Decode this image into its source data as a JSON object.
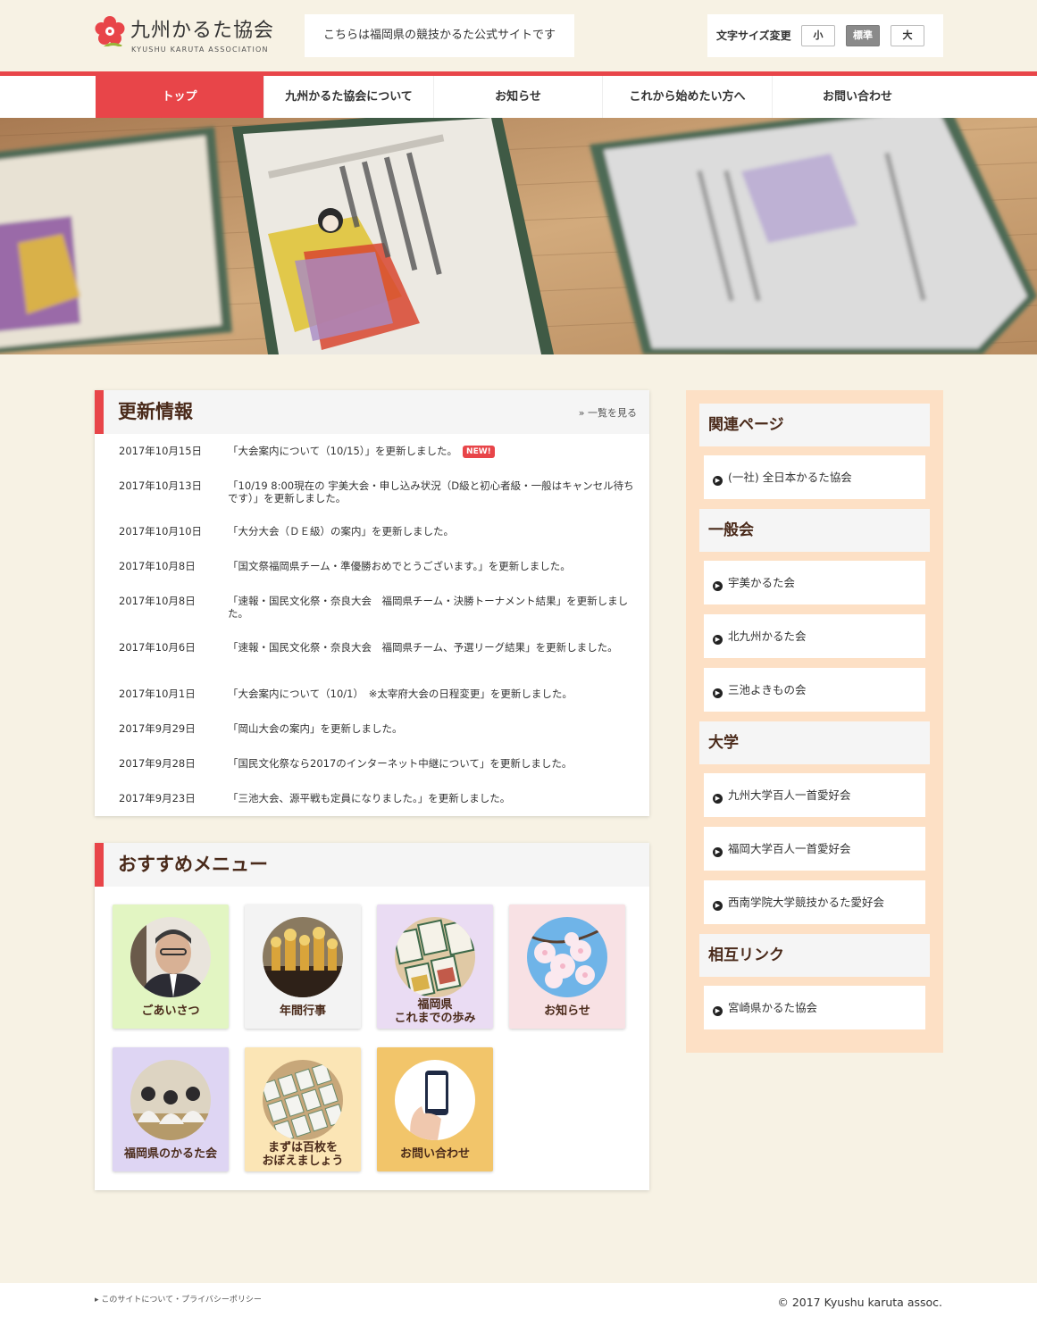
{
  "header": {
    "logo_title": "九州かるた協会",
    "logo_sub": "KYUSHU KARUTA ASSOCIATION",
    "tagline": "こちらは福岡県の競技かるた公式サイトです",
    "fontsize_label": "文字サイズ変更",
    "fontsize_small": "小",
    "fontsize_normal": "標準",
    "fontsize_large": "大"
  },
  "nav": {
    "items": [
      {
        "label": "トップ"
      },
      {
        "label": "九州かるた協会について"
      },
      {
        "label": "お知らせ"
      },
      {
        "label": "これから始めたい方へ"
      },
      {
        "label": "お問い合わせ"
      }
    ]
  },
  "news": {
    "title": "更新情報",
    "more": "» 一覧を見る",
    "new_badge": "NEW!",
    "items": [
      {
        "date": "2017年10月15日",
        "text": "「大会案内について（10/15）」を更新しました。"
      },
      {
        "date": "2017年10月13日",
        "text": "「10/19 8:00現在の 宇美大会・申し込み状況（D級と初心者級・一般はキャンセル待ちです）」を更新しました。"
      },
      {
        "date": "2017年10月10日",
        "text": "「大分大会（ＤＥ級）の案内」を更新しました。"
      },
      {
        "date": "2017年10月8日",
        "text": "「国文祭福岡県チーム・準優勝おめでとうございます。」を更新しました。"
      },
      {
        "date": "2017年10月8日",
        "text": "「速報・国民文化祭・奈良大会　福岡県チーム・決勝トーナメント結果」を更新しました。"
      },
      {
        "date": "2017年10月6日",
        "text": "「速報・国民文化祭・奈良大会　福岡県チーム、予選リーグ結果」を更新しました。"
      },
      {
        "date": "2017年10月1日",
        "text": "「大会案内について（10/1）　※太宰府大会の日程変更」を更新しました。"
      },
      {
        "date": "2017年9月29日",
        "text": "「岡山大会の案内」を更新しました。"
      },
      {
        "date": "2017年9月28日",
        "text": "「国民文化祭なら2017のインターネット中継について」を更新しました。"
      },
      {
        "date": "2017年9月23日",
        "text": "「三池大会、源平戦も定員になりました。」を更新しました。"
      }
    ]
  },
  "menu": {
    "title": "おすすめメニュー",
    "tiles": [
      {
        "label": "ごあいさつ",
        "color": "#e2f5c2"
      },
      {
        "label": "年間行事",
        "color": "#f3f3f3"
      },
      {
        "label": "福岡県\nこれまでの歩み",
        "color": "#eadcf3"
      },
      {
        "label": "お知らせ",
        "color": "#f8e1e4"
      },
      {
        "label": "福岡県のかるた会",
        "color": "#ded5f3"
      },
      {
        "label": "まずは百枚を\nおぼえましょう",
        "color": "#fbe5b5"
      },
      {
        "label": "お問い合わせ",
        "color": "#f2c56a"
      }
    ]
  },
  "sidebar": {
    "sections": [
      {
        "title": "関連ページ",
        "links": [
          "(一社) 全日本かるた協会"
        ]
      },
      {
        "title": "一般会",
        "links": [
          "宇美かるた会",
          "北九州かるた会",
          "三池よきもの会"
        ]
      },
      {
        "title": "大学",
        "links": [
          "九州大学百人一首愛好会",
          "福岡大学百人一首愛好会",
          "西南学院大学競技かるた愛好会"
        ]
      },
      {
        "title": "相互リンク",
        "links": [
          "宮崎県かるた協会"
        ]
      }
    ]
  },
  "footer": {
    "links": "▸ このサイトについて・プライバシーポリシー",
    "copyright": "© 2017 Kyushu karuta assoc."
  },
  "colors": {
    "accent": "#e84549",
    "background": "#f7f2e4",
    "sidebar": "#fde0c5"
  }
}
